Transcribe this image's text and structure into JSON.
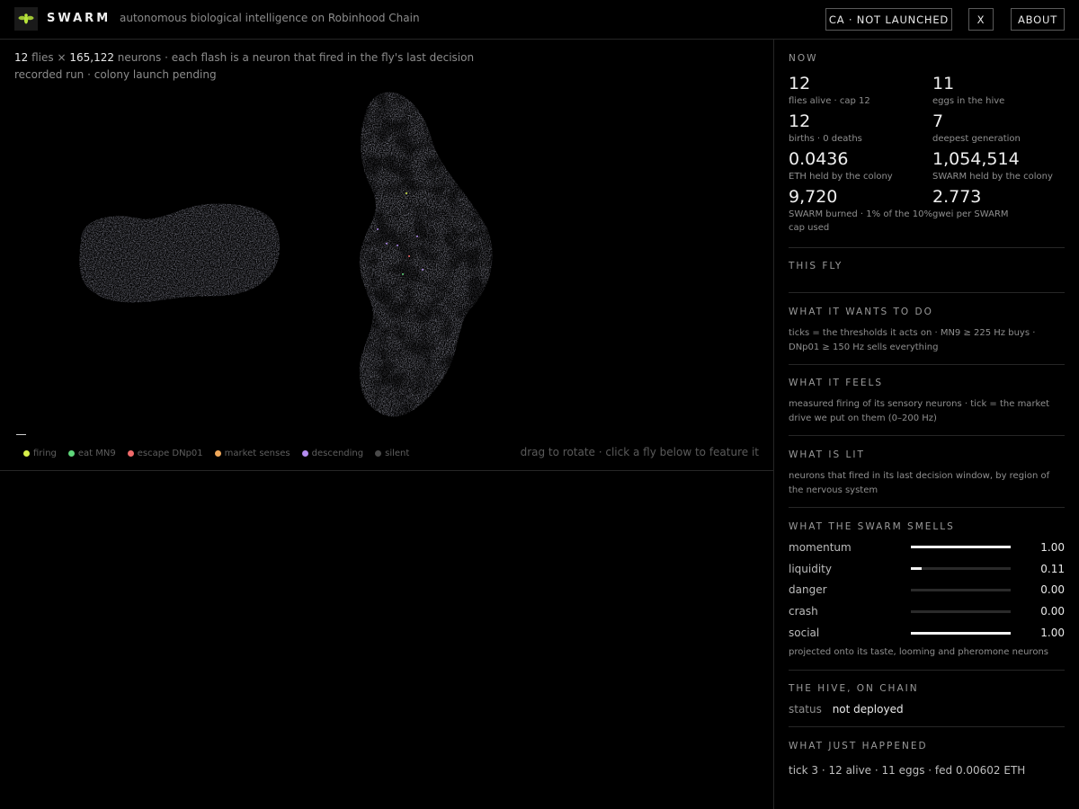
{
  "header": {
    "brand": "SWARM",
    "tagline": "autonomous biological intelligence on Robinhood Chain",
    "ca_button": "CA · NOT LAUNCHED",
    "x_button": "X",
    "about_button": "ABOUT",
    "logo_icon": "fly-logo-icon",
    "accent": "#b7e43a"
  },
  "viewer": {
    "flies_count": "12",
    "flies_label": "flies ×",
    "neurons_count": "165,122",
    "neurons_label": "neurons · each flash is a neuron that fired in the fly's last decision",
    "run_status": "recorded run · colony launch pending",
    "hint": "drag to rotate · click a fly below to feature it",
    "legend": [
      {
        "label": "firing",
        "color": "#d8f04a"
      },
      {
        "label": "eat MN9",
        "color": "#5fd67a"
      },
      {
        "label": "escape DNp01",
        "color": "#f06a6a"
      },
      {
        "label": "market senses",
        "color": "#f0a85a"
      },
      {
        "label": "descending",
        "color": "#b48cf0"
      },
      {
        "label": "silent",
        "color": "#4a4a4a"
      }
    ]
  },
  "panel": {
    "now_title": "NOW",
    "stats": [
      {
        "value": "12",
        "label": "flies alive · cap 12"
      },
      {
        "value": "11",
        "label": "eggs in the hive"
      },
      {
        "value": "12",
        "label": "births · 0 deaths"
      },
      {
        "value": "7",
        "label": "deepest generation"
      },
      {
        "value": "0.0436",
        "label": "ETH held by the colony"
      },
      {
        "value": "1,054,514",
        "label": "SWARM held by the colony"
      },
      {
        "value": "9,720",
        "label": "SWARM burned · 1% of the 10% cap used"
      },
      {
        "value": "2.773",
        "label": "gwei per SWARM"
      }
    ],
    "this_fly_title": "THIS FLY",
    "wants_title": "WHAT IT WANTS TO DO",
    "wants_desc": "ticks = the thresholds it acts on · MN9 ≥ 225 Hz buys · DNp01 ≥ 150 Hz sells everything",
    "feels_title": "WHAT IT FEELS",
    "feels_desc": "measured firing of its sensory neurons · tick = the market drive we put on them (0–200 Hz)",
    "lit_title": "WHAT IS LIT",
    "lit_desc": "neurons that fired in its last decision window, by region of the nervous system",
    "smells_title": "WHAT THE SWARM SMELLS",
    "smells": [
      {
        "name": "momentum",
        "value": 1.0,
        "display": "1.00"
      },
      {
        "name": "liquidity",
        "value": 0.11,
        "display": "0.11"
      },
      {
        "name": "danger",
        "value": 0.0,
        "display": "0.00"
      },
      {
        "name": "crash",
        "value": 0.0,
        "display": "0.00"
      },
      {
        "name": "social",
        "value": 1.0,
        "display": "1.00"
      }
    ],
    "smells_desc": "projected onto its taste, looming and pheromone neurons",
    "hive_title": "THE HIVE, ON CHAIN",
    "hive_status_label": "status",
    "hive_status_value": "not deployed",
    "happened_title": "WHAT JUST HAPPENED",
    "happened_line": "tick 3 · 12 alive · 11 eggs · fed 0.00602 ETH"
  }
}
